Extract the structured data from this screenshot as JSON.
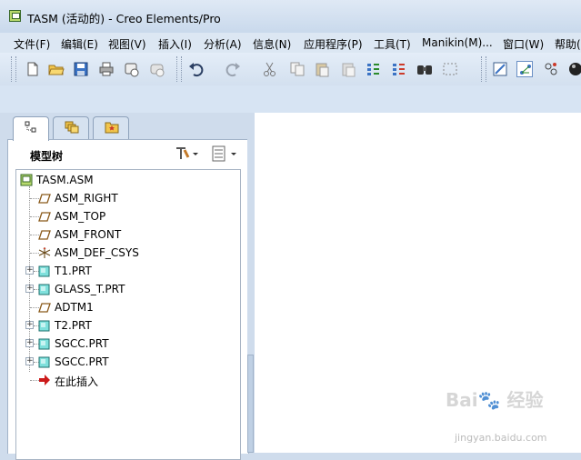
{
  "window": {
    "title": "TASM (活动的) - Creo Elements/Pro"
  },
  "menu": [
    "文件(F)",
    "编辑(E)",
    "视图(V)",
    "插入(I)",
    "分析(A)",
    "信息(N)",
    "应用程序(P)",
    "工具(T)",
    "Manikin(M)...",
    "窗口(W)",
    "帮助("
  ],
  "toolbar_icons": [
    "new-icon",
    "open-icon",
    "save-icon",
    "print-icon",
    "send-icon",
    "mail-icon",
    "undo-icon",
    "redo-icon",
    "cut-icon",
    "copy-icon",
    "paste-icon",
    "paste-special-icon",
    "regenerate-icon",
    "regen-manager-icon",
    "find-icon",
    "select-box-icon",
    "repaint-icon",
    "spin-center-icon",
    "orient-icon",
    "shading-icon"
  ],
  "nav_tabs": [
    "model-tree-tab-icon",
    "layer-tab-icon",
    "favorites-tab-icon"
  ],
  "model_tree": {
    "header": "模型树",
    "settings_icon": "tree-settings-icon",
    "show_icon": "tree-show-icon",
    "items": [
      {
        "label": "TASM.ASM",
        "icon": "assembly-icon",
        "expander": false
      },
      {
        "label": "ASM_RIGHT",
        "icon": "datum-plane-icon",
        "expander": false
      },
      {
        "label": "ASM_TOP",
        "icon": "datum-plane-icon",
        "expander": false
      },
      {
        "label": "ASM_FRONT",
        "icon": "datum-plane-icon",
        "expander": false
      },
      {
        "label": "ASM_DEF_CSYS",
        "icon": "csys-icon",
        "expander": false
      },
      {
        "label": "T1.PRT",
        "icon": "part-icon",
        "expander": true
      },
      {
        "label": "GLASS_T.PRT",
        "icon": "part-icon",
        "expander": true
      },
      {
        "label": "ADTM1",
        "icon": "datum-plane-icon",
        "expander": false
      },
      {
        "label": "T2.PRT",
        "icon": "part-icon",
        "expander": true
      },
      {
        "label": "SGCC.PRT",
        "icon": "part-icon",
        "expander": true
      },
      {
        "label": "SGCC.PRT",
        "icon": "part-icon",
        "expander": true
      },
      {
        "label": "在此插入",
        "icon": "insert-here-arrow-icon",
        "expander": false
      }
    ]
  },
  "watermark": {
    "main": "Bai🐾 经验",
    "sub": "jingyan.baidu.com"
  }
}
